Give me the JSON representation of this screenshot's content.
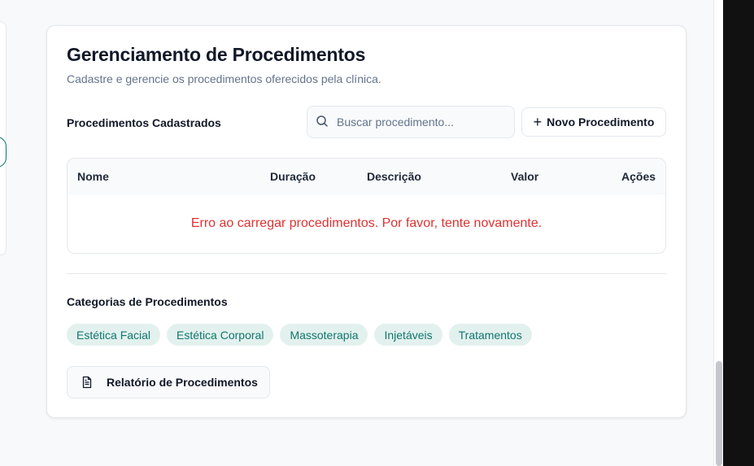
{
  "header": {
    "title": "Gerenciamento de Procedimentos",
    "subtitle": "Cadastre e gerencie os procedimentos oferecidos pela clínica."
  },
  "list": {
    "label": "Procedimentos Cadastrados",
    "search": {
      "placeholder": "Buscar procedimento...",
      "value": "",
      "icon": "search-icon"
    },
    "new_button": {
      "label": "Novo Procedimento",
      "icon": "plus-icon"
    }
  },
  "table": {
    "columns": [
      "Nome",
      "Duração",
      "Descrição",
      "Valor",
      "Ações"
    ],
    "error_message": "Erro ao carregar procedimentos. Por favor, tente novamente."
  },
  "categories": {
    "label": "Categorias de Procedimentos",
    "items": [
      "Estética Facial",
      "Estética Corporal",
      "Massoterapia",
      "Injetáveis",
      "Tratamentos"
    ]
  },
  "report_button": {
    "label": "Relatório de Procedimentos",
    "icon": "document-icon"
  },
  "colors": {
    "accent": "#0f766e",
    "chip_bg": "#e3f1ee",
    "error": "#e03131",
    "muted_text": "#64748b"
  }
}
